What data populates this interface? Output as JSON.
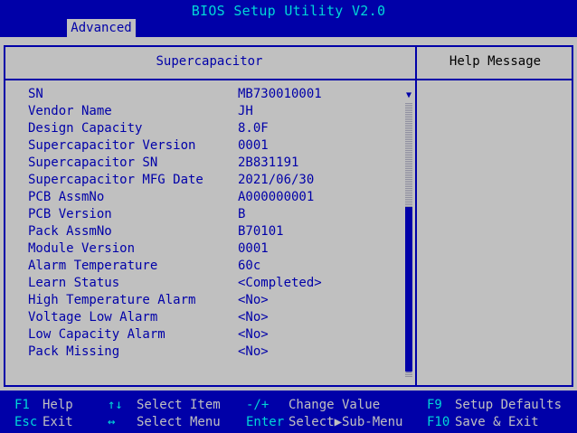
{
  "app_title": "BIOS Setup Utility V2.0",
  "active_tab": "Advanced",
  "left_header": "Supercapacitor",
  "right_header": "Help Message",
  "rows": [
    {
      "label": "SN",
      "value": "MB730010001"
    },
    {
      "label": "Vendor Name",
      "value": "JH"
    },
    {
      "label": "Design Capacity",
      "value": "8.0F"
    },
    {
      "label": "Supercapacitor Version",
      "value": "0001"
    },
    {
      "label": "Supercapacitor SN",
      "value": "2B831191"
    },
    {
      "label": "Supercapacitor MFG Date",
      "value": "2021/06/30"
    },
    {
      "label": "PCB AssmNo",
      "value": "A000000001"
    },
    {
      "label": "PCB Version",
      "value": "B"
    },
    {
      "label": "Pack AssmNo",
      "value": "B70101"
    },
    {
      "label": "Module Version",
      "value": "0001"
    },
    {
      "label": "Alarm Temperature",
      "value": "60c"
    },
    {
      "label": "Learn Status",
      "value": "<Completed>"
    },
    {
      "label": "High Temperature Alarm",
      "value": "<No>"
    },
    {
      "label": "Voltage Low Alarm",
      "value": "<No>"
    },
    {
      "label": "Low Capacity Alarm",
      "value": "<No>"
    },
    {
      "label": "Pack Missing",
      "value": "<No>"
    }
  ],
  "scroll": {
    "up_arrow": "▼",
    "down_arrow": "▲"
  },
  "footer": {
    "f1_key": "F1",
    "f1_desc": "Help",
    "esc_key": "Esc",
    "esc_desc": "Exit",
    "arrows_ud_key": "↑↓",
    "arrows_ud_desc": "Select Item",
    "arrows_lr_key": "↔",
    "arrows_lr_desc": "Select Menu",
    "plusminus_key": "-/+",
    "plusminus_desc": "Change Value",
    "enter_key": "Enter",
    "enter_desc": "Select▶Sub-Menu",
    "f9_key": "F9",
    "f9_desc": "Setup Defaults",
    "f10_key": "F10",
    "f10_desc": "Save & Exit"
  },
  "colors": {
    "background": "#0000a8",
    "panel": "#c0c0c0",
    "accent": "#00d7d7"
  }
}
